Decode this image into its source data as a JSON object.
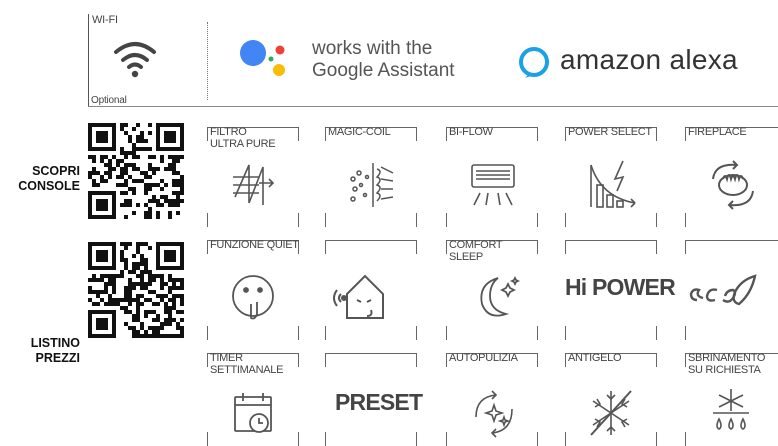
{
  "wifi": {
    "title": "WI-FI",
    "optional": "Optional",
    "icon": "wifi-icon"
  },
  "partners": {
    "google_line1": "works with the",
    "google_line2": "Google Assistant",
    "alexa": "amazon alexa"
  },
  "qr": {
    "console_line1": "SCOPRI",
    "console_line2": "CONSOLE",
    "prezzi_line1": "LISTINO",
    "prezzi_line2": "PREZZI"
  },
  "features": {
    "row1": [
      {
        "label_line1": "FILTRO",
        "label_line2": "ULTRA PURE",
        "icon": "filter-icon"
      },
      {
        "label_line1": "MAGIC-COIL",
        "label_line2": "",
        "icon": "magic-coil-icon"
      },
      {
        "label_line1": "BI-FLOW",
        "label_line2": "",
        "icon": "bi-flow-icon"
      },
      {
        "label_line1": "POWER SELECT",
        "label_line2": "",
        "icon": "power-select-icon"
      },
      {
        "label_line1": "FIREPLACE",
        "label_line2": "",
        "icon": "fireplace-icon"
      }
    ],
    "row2": [
      {
        "label_line1": "FUNZIONE QUIET",
        "label_line2": "",
        "icon": "quiet-icon"
      },
      {
        "label_line1": "",
        "label_line2": "",
        "icon": "house-sound-icon"
      },
      {
        "label_line1": "COMFORT",
        "label_line2": "SLEEP",
        "icon": "moon-icon"
      },
      {
        "label_line1": "",
        "label_line2": "",
        "text": "Hi POWER"
      },
      {
        "label_line1": "",
        "label_line2": "",
        "icon": "eco-icon"
      }
    ],
    "row3": [
      {
        "label_line1": "TIMER",
        "label_line2": "SETTIMANALE",
        "icon": "calendar-timer-icon"
      },
      {
        "label_line1": "",
        "label_line2": "",
        "text": "PRESET"
      },
      {
        "label_line1": "AUTOPULIZIA",
        "label_line2": "",
        "icon": "autoclean-icon"
      },
      {
        "label_line1": "ANTIGELO",
        "label_line2": "",
        "icon": "antifreeze-icon"
      },
      {
        "label_line1": "SBRINAMENTO",
        "label_line2": "SU RICHIESTA",
        "icon": "defrost-icon"
      }
    ]
  },
  "colors": {
    "google_blue": "#4285F4",
    "google_red": "#EA4335",
    "google_yellow": "#FBBC05",
    "google_green": "#34A853",
    "alexa_blue": "#1AA1E6",
    "icon_gray": "#555555"
  }
}
